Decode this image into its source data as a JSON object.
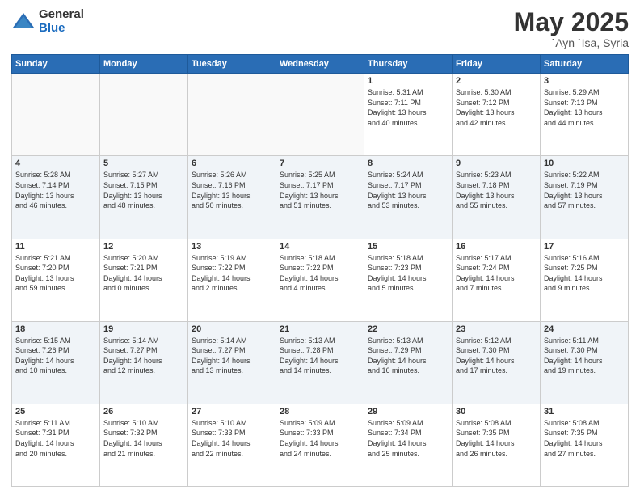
{
  "header": {
    "logo_general": "General",
    "logo_blue": "Blue",
    "title": "May 2025",
    "location": "`Ayn `Isa, Syria"
  },
  "days_of_week": [
    "Sunday",
    "Monday",
    "Tuesday",
    "Wednesday",
    "Thursday",
    "Friday",
    "Saturday"
  ],
  "weeks": [
    [
      {
        "day": "",
        "info": ""
      },
      {
        "day": "",
        "info": ""
      },
      {
        "day": "",
        "info": ""
      },
      {
        "day": "",
        "info": ""
      },
      {
        "day": "1",
        "info": "Sunrise: 5:31 AM\nSunset: 7:11 PM\nDaylight: 13 hours\nand 40 minutes."
      },
      {
        "day": "2",
        "info": "Sunrise: 5:30 AM\nSunset: 7:12 PM\nDaylight: 13 hours\nand 42 minutes."
      },
      {
        "day": "3",
        "info": "Sunrise: 5:29 AM\nSunset: 7:13 PM\nDaylight: 13 hours\nand 44 minutes."
      }
    ],
    [
      {
        "day": "4",
        "info": "Sunrise: 5:28 AM\nSunset: 7:14 PM\nDaylight: 13 hours\nand 46 minutes."
      },
      {
        "day": "5",
        "info": "Sunrise: 5:27 AM\nSunset: 7:15 PM\nDaylight: 13 hours\nand 48 minutes."
      },
      {
        "day": "6",
        "info": "Sunrise: 5:26 AM\nSunset: 7:16 PM\nDaylight: 13 hours\nand 50 minutes."
      },
      {
        "day": "7",
        "info": "Sunrise: 5:25 AM\nSunset: 7:17 PM\nDaylight: 13 hours\nand 51 minutes."
      },
      {
        "day": "8",
        "info": "Sunrise: 5:24 AM\nSunset: 7:17 PM\nDaylight: 13 hours\nand 53 minutes."
      },
      {
        "day": "9",
        "info": "Sunrise: 5:23 AM\nSunset: 7:18 PM\nDaylight: 13 hours\nand 55 minutes."
      },
      {
        "day": "10",
        "info": "Sunrise: 5:22 AM\nSunset: 7:19 PM\nDaylight: 13 hours\nand 57 minutes."
      }
    ],
    [
      {
        "day": "11",
        "info": "Sunrise: 5:21 AM\nSunset: 7:20 PM\nDaylight: 13 hours\nand 59 minutes."
      },
      {
        "day": "12",
        "info": "Sunrise: 5:20 AM\nSunset: 7:21 PM\nDaylight: 14 hours\nand 0 minutes."
      },
      {
        "day": "13",
        "info": "Sunrise: 5:19 AM\nSunset: 7:22 PM\nDaylight: 14 hours\nand 2 minutes."
      },
      {
        "day": "14",
        "info": "Sunrise: 5:18 AM\nSunset: 7:22 PM\nDaylight: 14 hours\nand 4 minutes."
      },
      {
        "day": "15",
        "info": "Sunrise: 5:18 AM\nSunset: 7:23 PM\nDaylight: 14 hours\nand 5 minutes."
      },
      {
        "day": "16",
        "info": "Sunrise: 5:17 AM\nSunset: 7:24 PM\nDaylight: 14 hours\nand 7 minutes."
      },
      {
        "day": "17",
        "info": "Sunrise: 5:16 AM\nSunset: 7:25 PM\nDaylight: 14 hours\nand 9 minutes."
      }
    ],
    [
      {
        "day": "18",
        "info": "Sunrise: 5:15 AM\nSunset: 7:26 PM\nDaylight: 14 hours\nand 10 minutes."
      },
      {
        "day": "19",
        "info": "Sunrise: 5:14 AM\nSunset: 7:27 PM\nDaylight: 14 hours\nand 12 minutes."
      },
      {
        "day": "20",
        "info": "Sunrise: 5:14 AM\nSunset: 7:27 PM\nDaylight: 14 hours\nand 13 minutes."
      },
      {
        "day": "21",
        "info": "Sunrise: 5:13 AM\nSunset: 7:28 PM\nDaylight: 14 hours\nand 14 minutes."
      },
      {
        "day": "22",
        "info": "Sunrise: 5:13 AM\nSunset: 7:29 PM\nDaylight: 14 hours\nand 16 minutes."
      },
      {
        "day": "23",
        "info": "Sunrise: 5:12 AM\nSunset: 7:30 PM\nDaylight: 14 hours\nand 17 minutes."
      },
      {
        "day": "24",
        "info": "Sunrise: 5:11 AM\nSunset: 7:30 PM\nDaylight: 14 hours\nand 19 minutes."
      }
    ],
    [
      {
        "day": "25",
        "info": "Sunrise: 5:11 AM\nSunset: 7:31 PM\nDaylight: 14 hours\nand 20 minutes."
      },
      {
        "day": "26",
        "info": "Sunrise: 5:10 AM\nSunset: 7:32 PM\nDaylight: 14 hours\nand 21 minutes."
      },
      {
        "day": "27",
        "info": "Sunrise: 5:10 AM\nSunset: 7:33 PM\nDaylight: 14 hours\nand 22 minutes."
      },
      {
        "day": "28",
        "info": "Sunrise: 5:09 AM\nSunset: 7:33 PM\nDaylight: 14 hours\nand 24 minutes."
      },
      {
        "day": "29",
        "info": "Sunrise: 5:09 AM\nSunset: 7:34 PM\nDaylight: 14 hours\nand 25 minutes."
      },
      {
        "day": "30",
        "info": "Sunrise: 5:08 AM\nSunset: 7:35 PM\nDaylight: 14 hours\nand 26 minutes."
      },
      {
        "day": "31",
        "info": "Sunrise: 5:08 AM\nSunset: 7:35 PM\nDaylight: 14 hours\nand 27 minutes."
      }
    ]
  ]
}
